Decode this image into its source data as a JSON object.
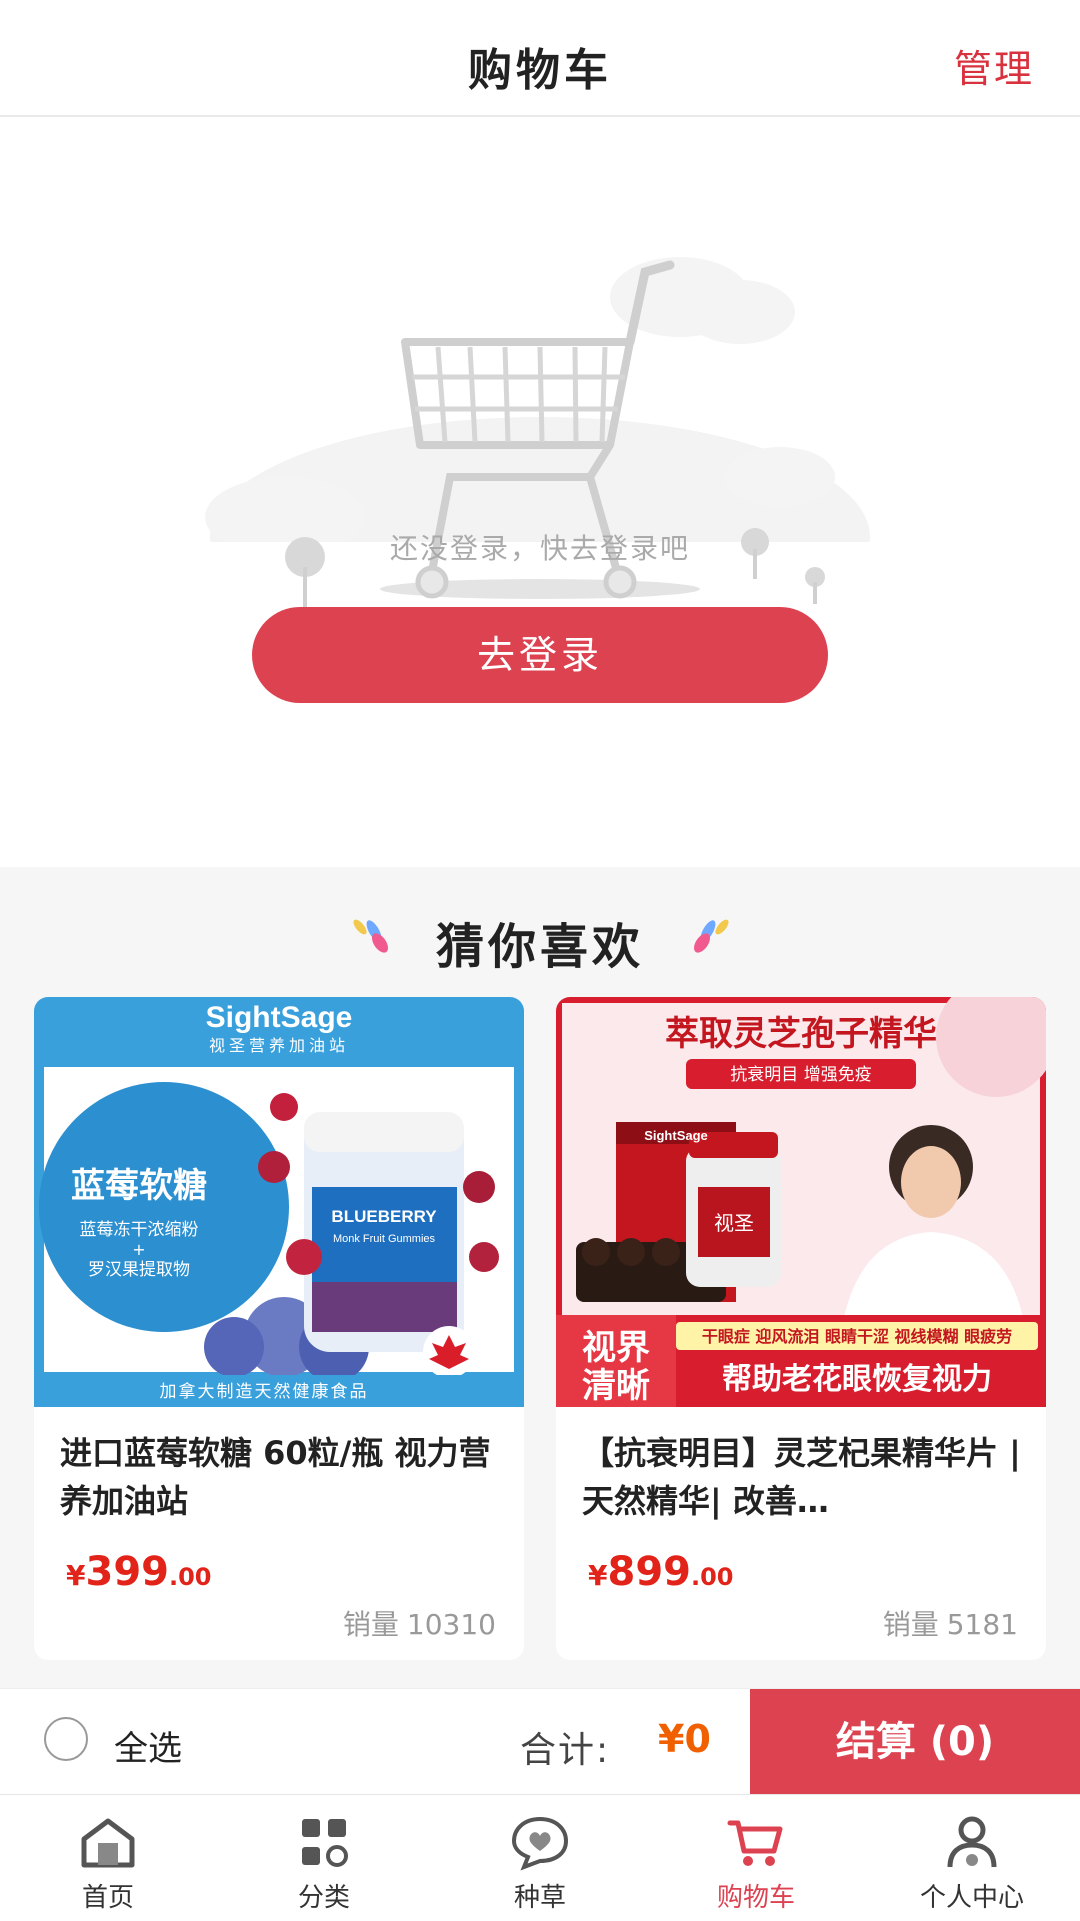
{
  "header": {
    "title": "购物车",
    "manage_label": "管理"
  },
  "empty_state": {
    "message": "还没登录，快去登录吧",
    "login_button": "去登录"
  },
  "recommend": {
    "title": "猜你喜欢",
    "products": [
      {
        "name": "进口蓝莓软糖 60粒/瓶 视力营养加油站",
        "price_symbol": "¥",
        "price_int": "399",
        "price_dec": ".00",
        "sales_label": "销量",
        "sales_value": "10310",
        "image": {
          "brand": "SightSage",
          "brand_sub": "视圣营养加油站",
          "headline": "蓝莓软糖",
          "line1": "蓝莓冻干浓缩粉",
          "plus": "+",
          "line2": "罗汉果提取物",
          "bottle_label": "BLUEBERRY",
          "bottle_sub": "Monk Fruit Gummies",
          "footer": "加拿大制造天然健康食品"
        }
      },
      {
        "name": "【抗衰明目】灵芝杞果精华片 | 天然精华| 改善…",
        "price_symbol": "¥",
        "price_int": "899",
        "price_dec": ".00",
        "sales_label": "销量",
        "sales_value": "5181",
        "image": {
          "headline": "萃取灵芝孢子精华",
          "tag": "抗衰明目 增强免疫",
          "box_brand": "SightSage",
          "jar_label": "视圣",
          "symptoms": "干眼症 迎风流泪 眼睛干涩 视线模糊 眼疲劳",
          "badge_line1": "视界",
          "badge_line2": "清晰",
          "footer": "帮助老花眼恢复视力"
        }
      }
    ]
  },
  "checkout_bar": {
    "select_all": "全选",
    "total_label": "合计:",
    "total_value": "¥0",
    "checkout_button": "结算 (0)"
  },
  "tabbar": {
    "items": [
      {
        "label": "首页",
        "icon": "home-icon"
      },
      {
        "label": "分类",
        "icon": "grid-icon"
      },
      {
        "label": "种草",
        "icon": "heart-chat-icon"
      },
      {
        "label": "购物车",
        "icon": "cart-icon",
        "active": true
      },
      {
        "label": "个人中心",
        "icon": "user-icon"
      }
    ]
  },
  "colors": {
    "accent": "#dc4250",
    "price": "#e2231a",
    "total": "#f06000"
  }
}
